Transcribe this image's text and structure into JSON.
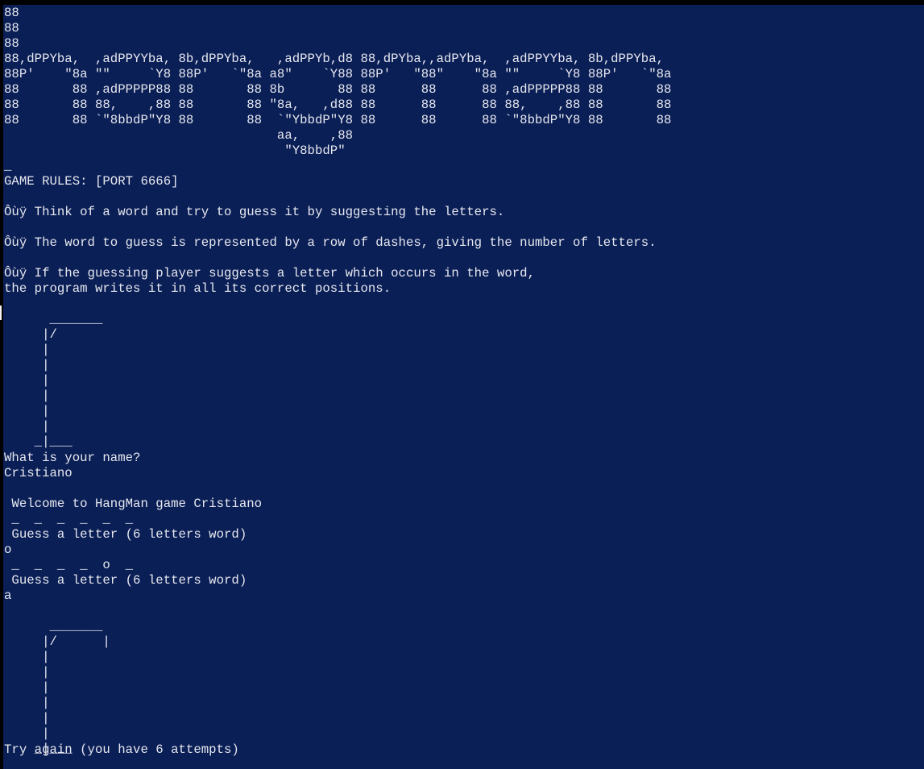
{
  "colors": {
    "background": "#0b1f57",
    "text": "#e6e8ee",
    "border": "#000000"
  },
  "banner_ascii": "88\n88\n88\n88,dPPYba,  ,adPPYYba, 8b,dPPYba,   ,adPPYb,d8 88,dPYba,,adPYba,  ,adPPYYba, 8b,dPPYba,\n88P'    \"8a \"\"     `Y8 88P'   `\"8a a8\"    `Y88 88P'   \"88\"    \"8a \"\"     `Y8 88P'   `\"8a\n88       88 ,adPPPPP88 88       88 8b       88 88      88      88 ,adPPPPP88 88       88\n88       88 88,    ,88 88       88 \"8a,   ,d88 88      88      88 88,    ,88 88       88\n88       88 `\"8bbdP\"Y8 88       88  `\"YbbdP\"Y8 88      88      88 `\"8bbdP\"Y8 88       88\n                                    aa,    ,88\n                                     \"Y8bbdP\"\n_",
  "rules": {
    "header": "GAME RULES: [PORT 6666]",
    "rule1": "Ôùÿ Think of a word and try to guess it by suggesting the letters.",
    "rule2": "Ôùÿ The word to guess is represented by a row of dashes, giving the number of letters.",
    "rule3_line1": "Ôùÿ If the guessing player suggests a letter which occurs in the word,",
    "rule3_line2": "the program writes it in all its correct positions."
  },
  "gallows_initial": "      _______\n     |/\n     |\n     |\n     |\n     |\n     |\n     |\n    _|___",
  "session": {
    "name_prompt": "What is your name?",
    "name_input": "Cristiano",
    "welcome": " Welcome to HangMan game Cristiano",
    "dashes_1": " _  _  _  _  _  _",
    "guess_prompt_1": " Guess a letter (6 letters word)",
    "guess_input_1": "o",
    "dashes_2": " _  _  _  _  o  _",
    "guess_prompt_2": " Guess a letter (6 letters word)",
    "guess_input_2": "a"
  },
  "gallows_after": "      _______\n     |/      |\n     |\n     |\n     |\n     |\n     |\n     |\n    _|___",
  "status": "Try again (you have 6 attempts)"
}
